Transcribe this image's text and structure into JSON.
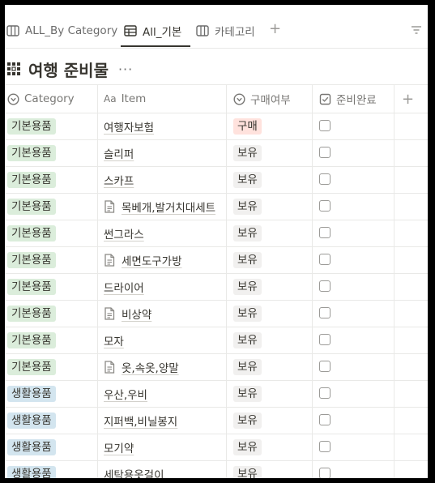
{
  "tabs": [
    {
      "label": "ALL_By Category",
      "icon": "table-icon",
      "active": false
    },
    {
      "label": "All_기본",
      "icon": "table-icon",
      "active": true
    },
    {
      "label": "카테고리",
      "icon": "board-icon",
      "active": false
    }
  ],
  "add_view_label": "+",
  "page": {
    "title": "여행 준비물",
    "more_label": "···"
  },
  "columns": [
    {
      "label": "Category",
      "icon": "select-icon"
    },
    {
      "label": "Item",
      "icon": "text-icon",
      "icon_text": "Aa"
    },
    {
      "label": "구매여부",
      "icon": "select-icon"
    },
    {
      "label": "준비완료",
      "icon": "checkbox-icon"
    }
  ],
  "add_column_label": "+",
  "colors": {
    "tag_basic": "#dbeddb",
    "tag_living": "#d3e5ef",
    "tag_buy": "#ffe2dd",
    "tag_own": "#f1f0ef"
  },
  "rows": [
    {
      "category": "기본용품",
      "item": "여행자보험",
      "has_doc": false,
      "status": "구매",
      "done": false
    },
    {
      "category": "기본용품",
      "item": "슬리퍼",
      "has_doc": false,
      "status": "보유",
      "done": false
    },
    {
      "category": "기본용품",
      "item": "스카프",
      "has_doc": false,
      "status": "보유",
      "done": false
    },
    {
      "category": "기본용품",
      "item": "목베개,발거치대세트",
      "has_doc": true,
      "status": "보유",
      "done": false
    },
    {
      "category": "기본용품",
      "item": "썬그라스",
      "has_doc": false,
      "status": "보유",
      "done": false
    },
    {
      "category": "기본용품",
      "item": "세면도구가방",
      "has_doc": true,
      "status": "보유",
      "done": false
    },
    {
      "category": "기본용품",
      "item": "드라이어",
      "has_doc": false,
      "status": "보유",
      "done": false
    },
    {
      "category": "기본용품",
      "item": "비상약",
      "has_doc": true,
      "status": "보유",
      "done": false
    },
    {
      "category": "기본용품",
      "item": "모자",
      "has_doc": false,
      "status": "보유",
      "done": false
    },
    {
      "category": "기본용품",
      "item": "옷,속옷,양말",
      "has_doc": true,
      "status": "보유",
      "done": false
    },
    {
      "category": "생활용품",
      "item": "우산,우비",
      "has_doc": false,
      "status": "보유",
      "done": false
    },
    {
      "category": "생활용품",
      "item": "지퍼백,비닐봉지",
      "has_doc": false,
      "status": "보유",
      "done": false
    },
    {
      "category": "생활용품",
      "item": "모기약",
      "has_doc": false,
      "status": "보유",
      "done": false
    },
    {
      "category": "생활용품",
      "item": "세탁용옷걸이",
      "has_doc": false,
      "status": "보유",
      "done": false
    }
  ]
}
